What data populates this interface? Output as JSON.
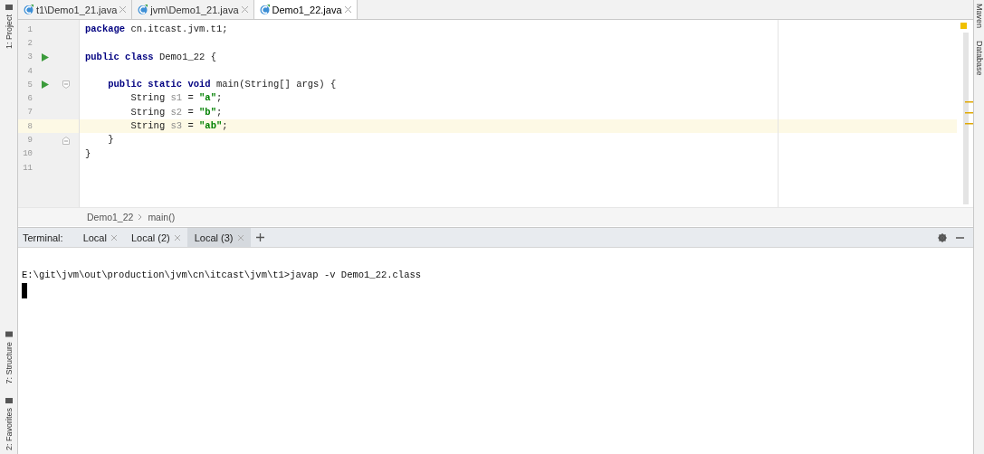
{
  "left_toolbar": {
    "top": [
      {
        "label": "1: Project"
      }
    ],
    "bottom": [
      {
        "label": "7: Structure"
      },
      {
        "label": "2: Favorites"
      }
    ]
  },
  "editor_tabs": [
    {
      "label": "t1\\Demo1_21.java",
      "selected": false
    },
    {
      "label": "jvm\\Demo1_21.java",
      "selected": false
    },
    {
      "label": "Demo1_22.java",
      "selected": true
    }
  ],
  "code_lines": [
    {
      "number": "1",
      "run": false,
      "fold_start": false,
      "fold_end": false,
      "current": false,
      "tokens": [
        {
          "kind": "keyword",
          "text": "package"
        },
        {
          "kind": "plain",
          "text": " cn.itcast.jvm.t1;"
        }
      ]
    },
    {
      "number": "2",
      "run": false,
      "fold_start": false,
      "fold_end": false,
      "current": false
    },
    {
      "number": "3",
      "run": true,
      "fold_start": false,
      "fold_end": false,
      "current": false,
      "tokens": [
        {
          "kind": "keyword",
          "text": "public class"
        },
        {
          "kind": "plain",
          "text": " Demo1_22 {"
        }
      ]
    },
    {
      "number": "4",
      "run": false,
      "fold_start": false,
      "fold_end": false,
      "current": false
    },
    {
      "number": "5",
      "run": true,
      "fold_start": true,
      "fold_end": false,
      "current": false,
      "tokens": [
        {
          "kind": "keyword",
          "text": "    public static void"
        },
        {
          "kind": "plain",
          "text": " main(String[] args) {"
        }
      ]
    },
    {
      "number": "6",
      "run": false,
      "fold_start": false,
      "fold_end": false,
      "current": false,
      "tokens": [
        {
          "kind": "plain",
          "text": "        String "
        },
        {
          "kind": "variable",
          "text": "s1"
        },
        {
          "kind": "plain",
          "text": " = "
        },
        {
          "kind": "string",
          "text": "\"a\""
        },
        {
          "kind": "plain",
          "text": ";"
        }
      ]
    },
    {
      "number": "7",
      "run": false,
      "fold_start": false,
      "fold_end": false,
      "current": false,
      "tokens": [
        {
          "kind": "plain",
          "text": "        String "
        },
        {
          "kind": "variable",
          "text": "s2"
        },
        {
          "kind": "plain",
          "text": " = "
        },
        {
          "kind": "string",
          "text": "\"b\""
        },
        {
          "kind": "plain",
          "text": ";"
        }
      ]
    },
    {
      "number": "8",
      "run": false,
      "fold_start": false,
      "fold_end": false,
      "current": true,
      "tokens": [
        {
          "kind": "plain",
          "text": "        String "
        },
        {
          "kind": "variable",
          "text": "s3"
        },
        {
          "kind": "plain",
          "text": " = "
        },
        {
          "kind": "string",
          "text": "\"ab\""
        },
        {
          "kind": "plain",
          "text": ";"
        }
      ]
    },
    {
      "number": "9",
      "run": false,
      "fold_start": false,
      "fold_end": true,
      "current": false,
      "tokens": [
        {
          "kind": "plain",
          "text": "    }"
        }
      ]
    },
    {
      "number": "10",
      "run": false,
      "fold_start": false,
      "fold_end": false,
      "current": false,
      "tokens": [
        {
          "kind": "plain",
          "text": "}"
        }
      ]
    },
    {
      "number": "11",
      "run": false,
      "fold_start": false,
      "fold_end": false,
      "current": false
    }
  ],
  "breadcrumb": [
    "Demo1_22",
    "main()"
  ],
  "terminal": {
    "title": "Terminal:",
    "tabs": [
      {
        "label": "Local",
        "selected": false
      },
      {
        "label": "Local (2)",
        "selected": false
      },
      {
        "label": "Local (3)",
        "selected": true
      }
    ],
    "lines": [
      "E:\\git\\jvm\\out\\production\\jvm\\cn\\itcast\\jvm\\t1>javap -v Demo1_22.class"
    ]
  },
  "right_toolbar": [
    {
      "label": "Maven"
    },
    {
      "label": "Database"
    }
  ]
}
